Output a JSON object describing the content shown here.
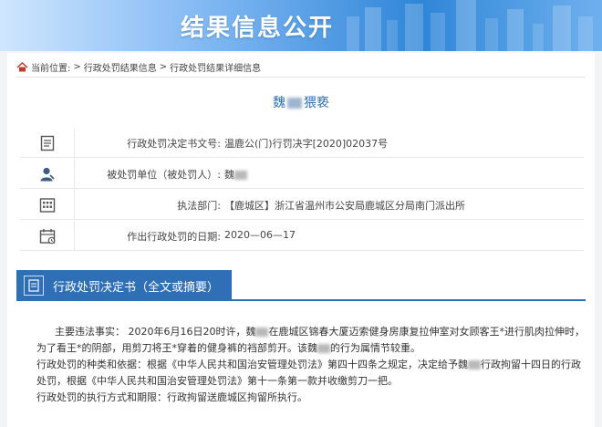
{
  "banner": {
    "title": "结果信息公开"
  },
  "breadcrumb": {
    "label": "当前位置:",
    "items": [
      "行政处罚结果信息",
      "行政处罚结果详细信息"
    ],
    "separator": ">"
  },
  "case": {
    "name_prefix": "魏",
    "name_suffix": "猥亵"
  },
  "fields": [
    {
      "icon": "document-icon",
      "label": "行政处罚决定书文号:",
      "value": "温鹿公(门)行罚决字[2020]02037号"
    },
    {
      "icon": "user-icon",
      "label": "被处罚单位（被处罚人）:",
      "value": "魏"
    },
    {
      "icon": "building-icon",
      "label": "执法部门:",
      "value": "【鹿城区】浙江省温州市公安局鹿城区分局南门派出所"
    },
    {
      "icon": "calendar-icon",
      "label": "作出行政处罚的日期:",
      "value": "2020—06—17"
    }
  ],
  "section": {
    "title": "行政处罚决定书（全文或摘要）"
  },
  "decision": {
    "p1a": "主要违法事实：  2020年6月16日20时许，魏",
    "p1b": "在鹿城区锦春大厦迈索健身房康复拉伸室对女顾客王*进行肌肉拉伸时，",
    "p2a": "为了看王*的阴部，用剪刀将王*穿着的健身裤的裆部剪开。该魏",
    "p2b": "的行为属情节较重。",
    "p3a": "行政处罚的种类和依据：根据《中华人民共和国治安管理处罚法》第四十四条之规定，决定给予魏",
    "p3b": "行政拘留十四日的行政",
    "p4": "处罚，根据《中华人民共和国治安管理处罚法》第十一条第一款并收缴剪刀一把。",
    "p5": "行政处罚的执行方式和期限：行政拘留送鹿城区拘留所执行。"
  }
}
